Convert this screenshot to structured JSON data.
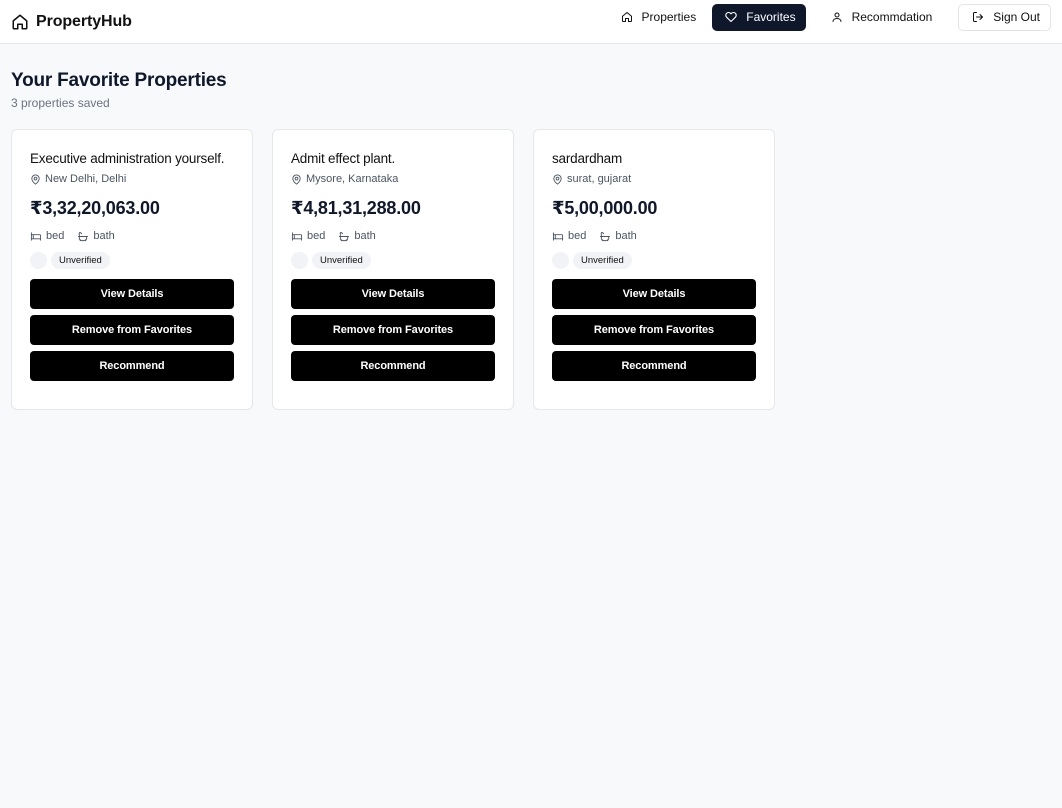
{
  "header": {
    "brand": "PropertyHub",
    "nav": {
      "properties": "Properties",
      "favorites": "Favorites",
      "recommendation": "Recommdation",
      "sign_out": "Sign Out"
    }
  },
  "page": {
    "title": "Your Favorite Properties",
    "subtitle": "3 properties saved"
  },
  "cards": [
    {
      "title": "Executive administration yourself.",
      "location": "New Delhi, Delhi",
      "price": "₹3,32,20,063.00",
      "bed": "bed",
      "bath": "bath",
      "status": "Unverified",
      "view": "View Details",
      "remove": "Remove from Favorites",
      "recommend": "Recommend"
    },
    {
      "title": "Admit effect plant.",
      "location": "Mysore, Karnataka",
      "price": "₹4,81,31,288.00",
      "bed": "bed",
      "bath": "bath",
      "status": "Unverified",
      "view": "View Details",
      "remove": "Remove from Favorites",
      "recommend": "Recommend"
    },
    {
      "title": "sardardham",
      "location": "surat, gujarat",
      "price": "₹5,00,000.00",
      "bed": "bed",
      "bath": "bath",
      "status": "Unverified",
      "view": "View Details",
      "remove": "Remove from Favorites",
      "recommend": "Recommend"
    }
  ],
  "colors": {
    "background": "#f8f9fb",
    "active_nav": "#0f172a",
    "button": "#000000",
    "badge": "#f1f3f6"
  },
  "icons": {
    "brand": "home-icon",
    "properties": "home-icon",
    "favorites": "heart-icon",
    "recommendation": "user-icon",
    "sign_out": "logout-icon",
    "location": "map-pin-icon",
    "bed": "bed-icon",
    "bath": "bath-icon"
  }
}
